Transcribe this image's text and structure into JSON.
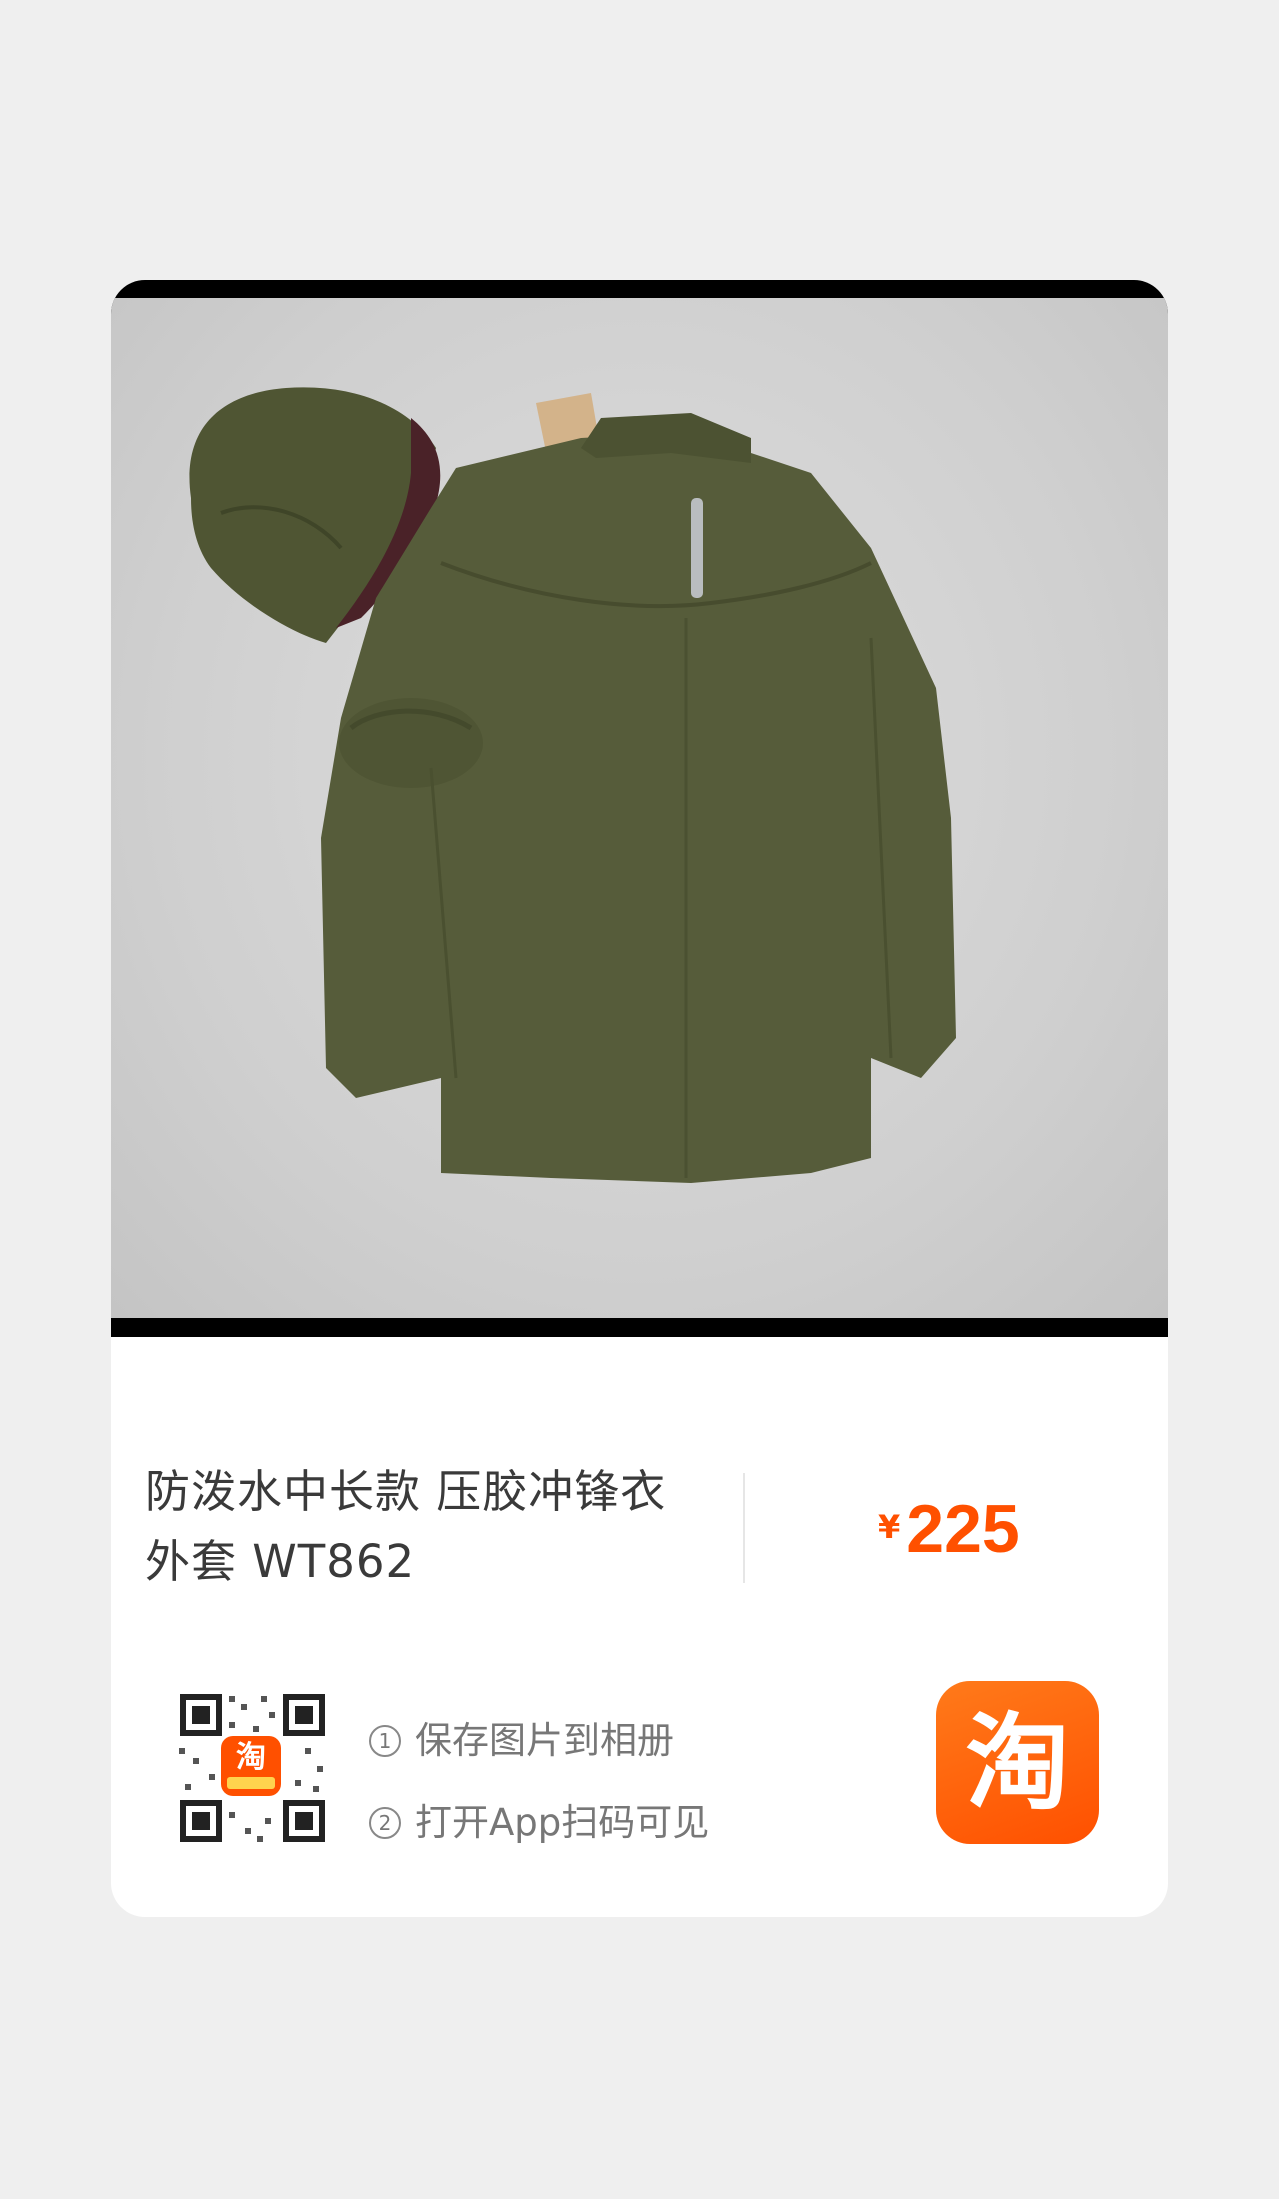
{
  "product": {
    "title_line1": "防泼水中长款 压胶冲锋衣",
    "title_line2": "外套 WT862",
    "currency_symbol": "¥",
    "price": "225",
    "image_icon": "olive-green-hooded-jacket-photo"
  },
  "share": {
    "step1_num": "1",
    "step1_text": "保存图片到相册",
    "step2_num": "2",
    "step2_text": "打开App扫码可见",
    "qr_icon": "qr-code-icon",
    "qr_badge_char": "淘"
  },
  "brand": {
    "logo_char": "淘",
    "logo_icon": "taobao-logo-icon",
    "accent_color": "#ff5000"
  }
}
